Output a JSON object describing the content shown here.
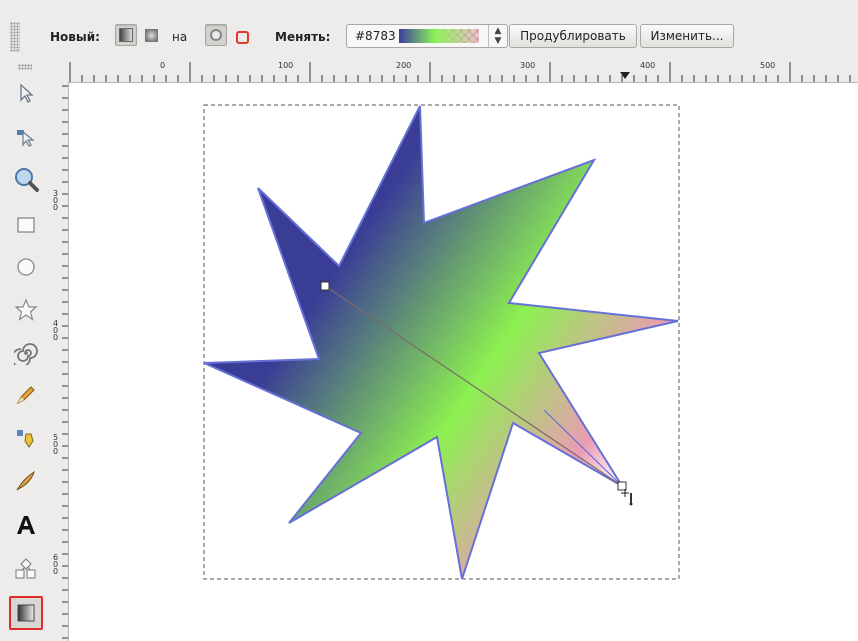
{
  "controls": {
    "new_label": "Новый:",
    "on_label": "на",
    "change_label": "Менять:",
    "gradient_name": "#8783",
    "duplicate_button": "Продублировать",
    "edit_button": "Изменить..."
  },
  "rulers": {
    "top_labels": [
      "0",
      "100",
      "200",
      "300",
      "400",
      "500"
    ],
    "left_labels": [
      "300",
      "400",
      "500",
      "600"
    ]
  },
  "toolbox": {
    "tools": [
      "selector-tool",
      "node-tool",
      "zoom-tool",
      "rectangle-tool",
      "ellipse-tool",
      "star-tool",
      "spiral-tool",
      "pencil-tool",
      "pen-tool",
      "calligraphy-tool",
      "text-tool",
      "connector-tool",
      "gradient-tool"
    ],
    "active_tool": "gradient-tool"
  },
  "gradient": {
    "stops": [
      "#3a3d96",
      "#8cf050",
      "#eb9cb4",
      "#ffffff"
    ]
  },
  "colors": {
    "star_stroke": "#6670d6",
    "selection_dash": "#555555",
    "active_tool_border": "#e22b2b"
  }
}
